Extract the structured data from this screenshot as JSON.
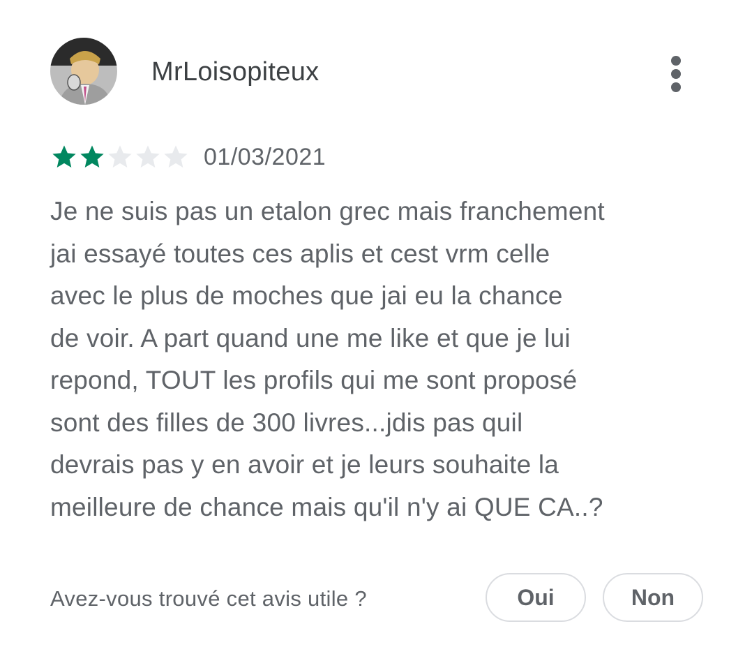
{
  "review": {
    "author": "MrLoisopiteux",
    "rating": 2,
    "max_rating": 5,
    "date": "01/03/2021",
    "text_lines": [
      "Je ne suis pas un etalon grec mais franchement",
      "jai essayé toutes ces aplis et cest vrm celle",
      "avec le plus de moches que jai eu la chance",
      "de voir. A part quand une me like et que je lui",
      "repond, TOUT les profils qui me sont proposé",
      "sont des filles de 300 livres...jdis pas quil",
      "devrais pas y en avoir et je leurs souhaite la",
      "meilleure de chance mais qu'il n'y ai QUE CA..?"
    ]
  },
  "icons": {
    "more": "more-vert-icon",
    "star": "star-icon"
  },
  "colors": {
    "star_filled": "#01875f",
    "star_empty": "#e8eaed",
    "text": "#5f6368",
    "author": "#3c4043",
    "pill_border": "#dadce0"
  },
  "helpful": {
    "question": "Avez-vous trouvé cet avis utile ?",
    "yes_label": "Oui",
    "no_label": "Non"
  }
}
